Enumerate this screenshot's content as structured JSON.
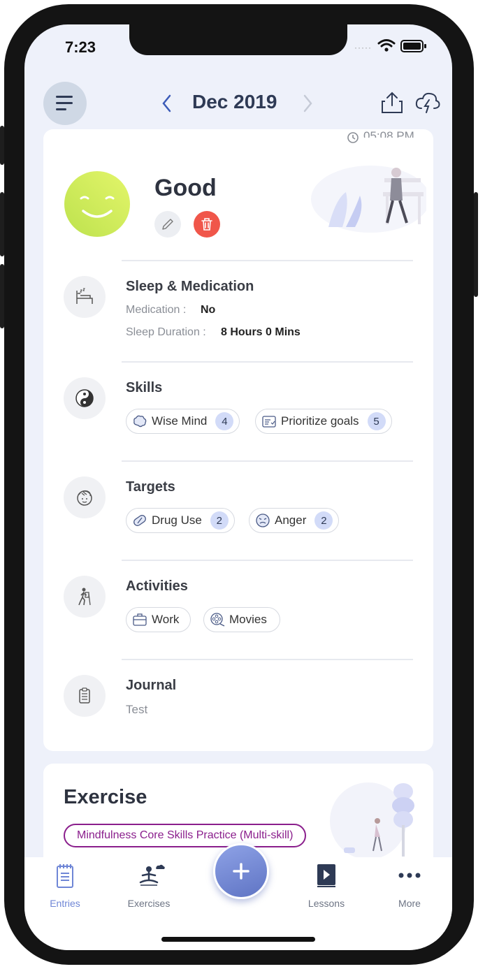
{
  "status_bar": {
    "time": "7:23"
  },
  "header": {
    "month": "Dec 2019",
    "prev_icon": "chevron-left-icon",
    "next_icon": "chevron-right-icon"
  },
  "entry": {
    "time": "05:08 PM",
    "mood": "Good",
    "mood_color": "#c8ea57",
    "delete_color": "#f0564a",
    "sleep": {
      "title": "Sleep & Medication",
      "medication_label": "Medication :",
      "medication_value": "No",
      "duration_label": "Sleep Duration :",
      "duration_value": "8 Hours 0 Mins"
    },
    "skills": {
      "title": "Skills",
      "items": [
        {
          "label": "Wise Mind",
          "count": "4",
          "icon": "brain-icon"
        },
        {
          "label": "Prioritize goals",
          "count": "5",
          "icon": "checklist-icon"
        }
      ]
    },
    "targets": {
      "title": "Targets",
      "items": [
        {
          "label": "Drug Use",
          "count": "2",
          "icon": "pill-icon"
        },
        {
          "label": "Anger",
          "count": "2",
          "icon": "angry-face-icon"
        }
      ]
    },
    "activities": {
      "title": "Activities",
      "items": [
        {
          "label": "Work",
          "icon": "briefcase-icon"
        },
        {
          "label": "Movies",
          "icon": "film-reel-icon"
        }
      ]
    },
    "journal": {
      "title": "Journal",
      "text": "Test"
    }
  },
  "exercise": {
    "title": "Exercise",
    "tag": "Mindfulness Core Skills Practice (Multi-skill)",
    "tag_color": "#8a1e8c"
  },
  "tabbar": {
    "accent": "#6f86d6",
    "items": [
      {
        "label": "Entries",
        "icon": "journal-icon"
      },
      {
        "label": "Exercises",
        "icon": "meditation-icon"
      },
      {
        "label": "Lessons",
        "icon": "video-book-icon"
      },
      {
        "label": "More",
        "icon": "more-dots-icon"
      }
    ]
  }
}
